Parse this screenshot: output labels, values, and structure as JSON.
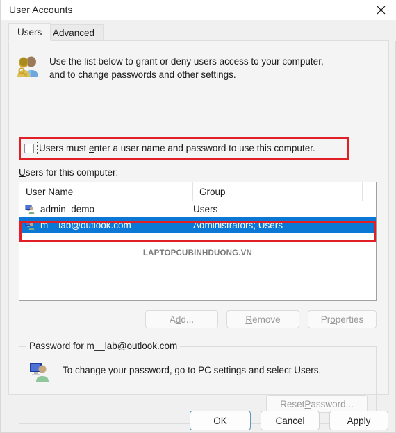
{
  "window": {
    "title": "User Accounts",
    "close_icon": "close-icon"
  },
  "tabs": [
    {
      "label": "Users",
      "selected": true
    },
    {
      "label": "Advanced",
      "selected": false
    }
  ],
  "intro": {
    "icon": "users-key-icon",
    "line1": "Use the list below to grant or deny users access to your computer,",
    "line2": "and to change passwords and other settings."
  },
  "checkbox": {
    "label_pre": "Users must ",
    "label_accel": "e",
    "label_post": "nter a user name and password to use this computer.",
    "checked": false,
    "focused": true,
    "highlight_color": "#e21f26"
  },
  "list": {
    "caption_accel": "U",
    "caption_rest": "sers for this computer:",
    "columns": [
      "User Name",
      "Group",
      ""
    ],
    "rows": [
      {
        "icon": "user-account-icon",
        "user_name": "admin_demo",
        "group": "Users",
        "selected": false
      },
      {
        "icon": "user-account-icon",
        "user_name": "m__lab@outlook.com",
        "group": "Administrators; Users",
        "selected": true
      }
    ],
    "selection_color": "#0a78d4",
    "watermark": "LAPTOPCUBINHDUONG.VN"
  },
  "list_buttons": [
    {
      "name": "add",
      "pre": "A",
      "accel": "d",
      "post": "d...",
      "disabled": true
    },
    {
      "name": "remove",
      "pre": "",
      "accel": "R",
      "post": "emove",
      "disabled": true
    },
    {
      "name": "properties",
      "pre": "Pr",
      "accel": "o",
      "post": "perties",
      "disabled": true
    }
  ],
  "password_group": {
    "legend": "Password for m__lab@outlook.com",
    "icon": "user-monitor-icon",
    "description": "To change your password, go to PC settings and select Users.",
    "reset_button": {
      "pre": "Reset ",
      "accel": "P",
      "post": "assword...",
      "disabled": true
    }
  },
  "footer_buttons": [
    {
      "name": "ok",
      "pre": "",
      "accel": "",
      "post": "OK",
      "default": true
    },
    {
      "name": "cancel",
      "pre": "",
      "accel": "",
      "post": "Cancel",
      "default": false
    },
    {
      "name": "apply",
      "pre": "",
      "accel": "A",
      "post": "pply",
      "default": false
    }
  ]
}
